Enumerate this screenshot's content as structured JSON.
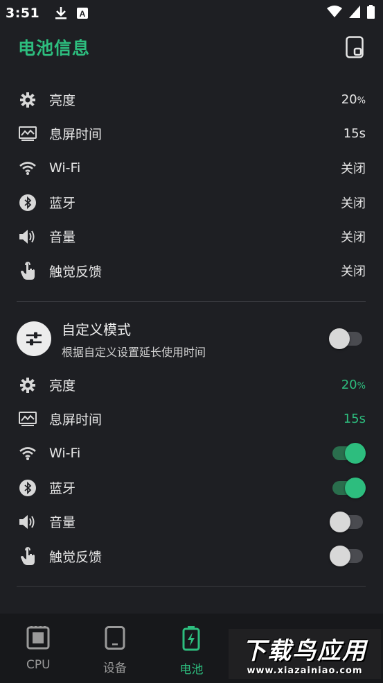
{
  "status_bar": {
    "time": "3:51",
    "icons": [
      "download-icon",
      "a-notification-icon",
      "wifi-icon",
      "cell-signal-icon",
      "battery-icon"
    ]
  },
  "header": {
    "title": "电池信息",
    "action_icon": "device-tablet-icon",
    "accent_color": "#2dbd7e"
  },
  "current_settings": [
    {
      "icon": "brightness-gear-icon",
      "label": "亮度",
      "value": "20",
      "unit": "%"
    },
    {
      "icon": "screen-timeout-icon",
      "label": "息屏时间",
      "value": "15s",
      "unit": ""
    },
    {
      "icon": "wifi-icon",
      "label": "Wi-Fi",
      "value": "关闭",
      "unit": ""
    },
    {
      "icon": "bluetooth-icon",
      "label": "蓝牙",
      "value": "关闭",
      "unit": ""
    },
    {
      "icon": "volume-icon",
      "label": "音量",
      "value": "关闭",
      "unit": ""
    },
    {
      "icon": "touch-icon",
      "label": "触觉反馈",
      "value": "关闭",
      "unit": ""
    }
  ],
  "custom_mode": {
    "icon": "sliders-icon",
    "title": "自定义模式",
    "subtitle": "根据自定义设置延长使用时间",
    "enabled": false,
    "settings": [
      {
        "icon": "brightness-gear-icon",
        "label": "亮度",
        "value": "20",
        "unit": "%"
      },
      {
        "icon": "screen-timeout-icon",
        "label": "息屏时间",
        "value": "15s",
        "unit": ""
      },
      {
        "icon": "wifi-icon",
        "label": "Wi-Fi",
        "toggle": true
      },
      {
        "icon": "bluetooth-icon",
        "label": "蓝牙",
        "toggle": true
      },
      {
        "icon": "volume-icon",
        "label": "音量",
        "toggle": false
      },
      {
        "icon": "touch-icon",
        "label": "触觉反馈",
        "toggle": false
      }
    ]
  },
  "bottom_nav": {
    "items": [
      {
        "label": "CPU",
        "icon": "cpu-chip-icon",
        "active": false
      },
      {
        "label": "设备",
        "icon": "tablet-icon",
        "active": false
      },
      {
        "label": "电池",
        "icon": "battery-charging-icon",
        "active": true
      }
    ]
  },
  "watermark": {
    "main": "下载鸟应用",
    "url": "www.xiazainiao.com"
  }
}
